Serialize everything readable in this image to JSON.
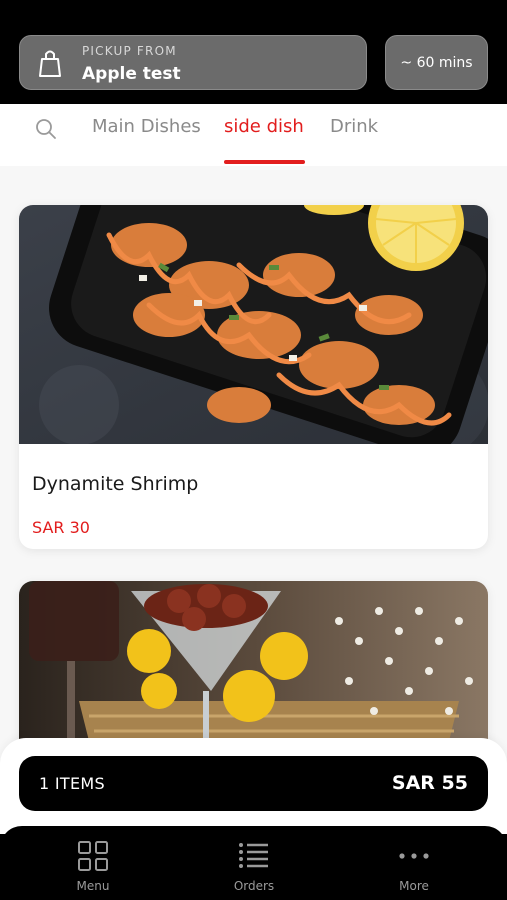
{
  "header": {
    "pickup_label": "PICKUP FROM",
    "pickup_value": "Apple test",
    "eta": "~ 60 mins"
  },
  "tabs": [
    {
      "label": "Main Dishes",
      "active": false
    },
    {
      "label": "side dish",
      "active": true
    },
    {
      "label": "Drink",
      "active": false
    }
  ],
  "items": [
    {
      "name": "Dynamite Shrimp",
      "price": "SAR 30",
      "image": "fried-shrimp-with-sauce-photo"
    },
    {
      "name": "",
      "price": "",
      "image": "cocktail-glass-dish-photo"
    }
  ],
  "cart": {
    "count": "1 ITEMS",
    "total": "SAR 55"
  },
  "nav": [
    {
      "label": "Menu",
      "icon": "grid-icon"
    },
    {
      "label": "Orders",
      "icon": "list-icon"
    },
    {
      "label": "More",
      "icon": "more-icon"
    }
  ],
  "colors": {
    "accent": "#e21d1d",
    "background": "#000000"
  }
}
